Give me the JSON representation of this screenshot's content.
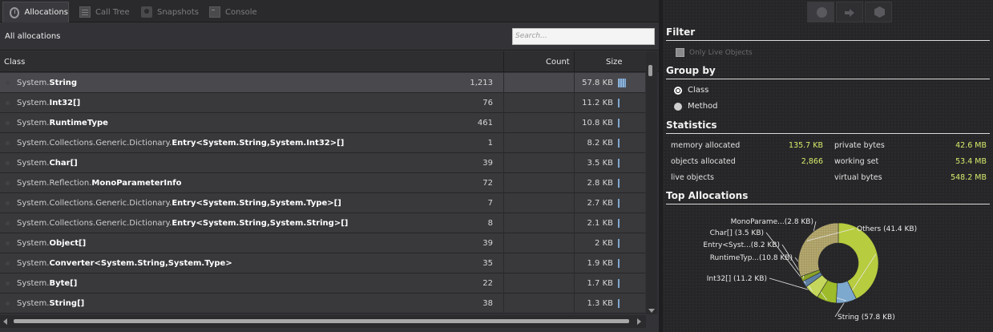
{
  "tabs": [
    {
      "label": "Allocations",
      "icon": "stopwatch-icon",
      "active": true
    },
    {
      "label": "Call Tree",
      "icon": "call-tree-icon",
      "active": false
    },
    {
      "label": "Snapshots",
      "icon": "camera-icon",
      "active": false
    },
    {
      "label": "Console",
      "icon": "console-icon",
      "active": false
    }
  ],
  "allocations": {
    "title": "All allocations",
    "search_placeholder": "Search..."
  },
  "table": {
    "columns": [
      "Class",
      "Count",
      "Size"
    ],
    "rows": [
      {
        "prefix": "System.",
        "name": "String",
        "suffix": "",
        "count": "1,213",
        "size": "57.8 KB",
        "share": 0.4255,
        "selected": true
      },
      {
        "prefix": "System.",
        "name": "Int32[]",
        "suffix": "",
        "count": "76",
        "size": "11.2 KB",
        "share": 0.0824,
        "selected": false
      },
      {
        "prefix": "System.",
        "name": "RuntimeType",
        "suffix": "",
        "count": "461",
        "size": "10.8 KB",
        "share": 0.0795,
        "selected": false
      },
      {
        "prefix": "System.Collections.Generic.Dictionary.",
        "name": "Entry<System.String,System.Int32>[]",
        "suffix": "",
        "count": "1",
        "size": "8.2 KB",
        "share": 0.0604,
        "selected": false
      },
      {
        "prefix": "System.",
        "name": "Char[]",
        "suffix": "",
        "count": "39",
        "size": "3.5 KB",
        "share": 0.0258,
        "selected": false
      },
      {
        "prefix": "System.Reflection.",
        "name": "MonoParameterInfo",
        "suffix": "",
        "count": "72",
        "size": "2.8 KB",
        "share": 0.0206,
        "selected": false
      },
      {
        "prefix": "System.Collections.Generic.Dictionary.",
        "name": "Entry<System.String,System.Type>[]",
        "suffix": "",
        "count": "7",
        "size": "2.7 KB",
        "share": 0.0199,
        "selected": false
      },
      {
        "prefix": "System.Collections.Generic.Dictionary.",
        "name": "Entry<System.String,System.String>[]",
        "suffix": "",
        "count": "8",
        "size": "2.1 KB",
        "share": 0.0155,
        "selected": false
      },
      {
        "prefix": "System.",
        "name": "Object[]",
        "suffix": "",
        "count": "39",
        "size": "2 KB",
        "share": 0.0147,
        "selected": false
      },
      {
        "prefix": "System.",
        "name": "Converter<System.String,System.Type>",
        "suffix": "",
        "count": "35",
        "size": "1.9 KB",
        "share": 0.014,
        "selected": false
      },
      {
        "prefix": "System.",
        "name": "Byte[]",
        "suffix": "",
        "count": "22",
        "size": "1.7 KB",
        "share": 0.0125,
        "selected": false
      },
      {
        "prefix": "System.",
        "name": "String[]",
        "suffix": "",
        "count": "38",
        "size": "1.3 KB",
        "share": 0.0096,
        "selected": false
      }
    ]
  },
  "toolbar": {
    "buttons": [
      "record-icon",
      "forward-arrow-icon",
      "package-icon"
    ]
  },
  "filter": {
    "title": "Filter",
    "only_live_label": "Only Live Objects",
    "only_live_checked": false
  },
  "group_by": {
    "title": "Group by",
    "options": [
      {
        "label": "Class",
        "selected": true
      },
      {
        "label": "Method",
        "selected": false
      }
    ]
  },
  "statistics": {
    "title": "Statistics",
    "left": [
      {
        "label": "memory allocated",
        "value": "135.7 KB"
      },
      {
        "label": "objects allocated",
        "value": "2,866"
      },
      {
        "label": "live objects",
        "value": ""
      }
    ],
    "right": [
      {
        "label": "private bytes",
        "value": "42.6 MB"
      },
      {
        "label": "working set",
        "value": "53.4 MB"
      },
      {
        "label": "virtual bytes",
        "value": "548.2 MB"
      }
    ]
  },
  "top_allocations": {
    "title": "Top Allocations"
  },
  "chart_data": {
    "type": "pie",
    "style": "donut",
    "title": "Top Allocations",
    "slices": [
      {
        "label": "String (57.8 KB)",
        "value": 57.8,
        "color": "#b7cc3e"
      },
      {
        "label": "Int32[] (11.2 KB)",
        "value": 11.2,
        "color": "#7ea9cf"
      },
      {
        "label": "RuntimeTyp...(10.8 KB)",
        "value": 10.8,
        "color": "#9dbb2a"
      },
      {
        "label": "Entry<Syst...(8.2 KB)",
        "value": 8.2,
        "color": "#c4d75c"
      },
      {
        "label": "Char[] (3.5 KB)",
        "value": 3.5,
        "color": "#5d7fa3"
      },
      {
        "label": "MonoParame...(2.8 KB)",
        "value": 2.8,
        "color": "#8aa128"
      },
      {
        "label": "Others (41.4 KB)",
        "value": 41.4,
        "color": "#a89c63"
      }
    ]
  }
}
